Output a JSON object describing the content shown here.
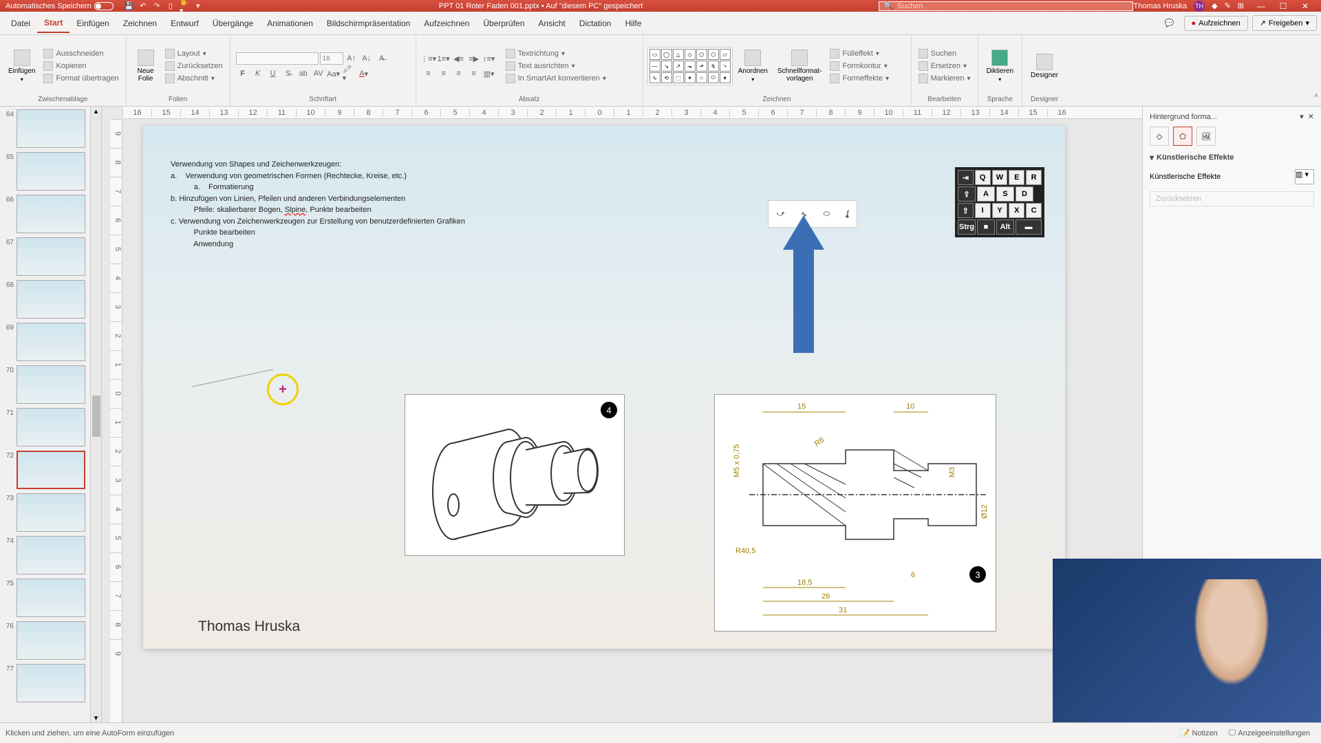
{
  "titlebar": {
    "autosave": "Automatisches Speichern",
    "filename": "PPT 01 Roter Faden 001.pptx • Auf \"diesem PC\" gespeichert",
    "search_placeholder": "Suchen",
    "user": "Thomas Hruska",
    "user_initials": "TH"
  },
  "tabs": {
    "items": [
      "Datei",
      "Start",
      "Einfügen",
      "Zeichnen",
      "Entwurf",
      "Übergänge",
      "Animationen",
      "Bildschirmpräsentation",
      "Aufzeichnen",
      "Überprüfen",
      "Ansicht",
      "Dictation",
      "Hilfe"
    ],
    "active": 1,
    "record": "Aufzeichnen",
    "share": "Freigeben"
  },
  "ribbon": {
    "clipboard": {
      "title": "Zwischenablage",
      "paste": "Einfügen",
      "cut": "Ausschneiden",
      "copy": "Kopieren",
      "format": "Format übertragen"
    },
    "slides": {
      "title": "Folien",
      "new": "Neue\nFolie",
      "layout": "Layout",
      "reset": "Zurücksetzen",
      "section": "Abschnitt"
    },
    "font": {
      "title": "Schriftart",
      "size": "18"
    },
    "paragraph": {
      "title": "Absatz",
      "dir": "Textrichtung",
      "align": "Text ausrichten",
      "smartart": "In SmartArt konvertieren"
    },
    "drawing": {
      "title": "Zeichnen",
      "arrange": "Anordnen",
      "quick": "Schnellformat-\nvorlagen",
      "fill": "Fülleffekt",
      "outline": "Formkontur",
      "effects": "Formeffekte"
    },
    "editing": {
      "title": "Bearbeiten",
      "find": "Suchen",
      "replace": "Ersetzen",
      "select": "Markieren"
    },
    "voice": {
      "title": "Sprache",
      "dictate": "Diktieren"
    },
    "designer": {
      "title": "Designer",
      "btn": "Designer"
    }
  },
  "thumbs": {
    "start": 64,
    "hasStar": [
      65,
      67,
      69,
      70
    ],
    "selected": 72
  },
  "slide": {
    "lines": [
      "Verwendung von Shapes und Zeichenwerkzeugen:",
      "a.    Verwendung von geometrischen Formen (Rechtecke, Kreise, etc.)",
      "           a.    Formatierung",
      "b. Hinzufügen von Linien, Pfeilen und anderen Verbindungselementen",
      "           Pfeile: skalierbarer Bogen, ",
      ", Punkte bearbeiten",
      "c. Verwendung von Zeichenwerkzeugen zur Erstellung von benutzerdefinierten Grafiken",
      "           Punkte bearbeiten",
      "           Anwendung"
    ],
    "slpine": "Slpine",
    "author": "Thomas Hruska",
    "badge4": "4",
    "badge3": "3",
    "kbd_rows": [
      [
        "⇥",
        "Q",
        "W",
        "E",
        "R"
      ],
      [
        "⇪",
        "A",
        "S",
        "D"
      ],
      [
        "⇧",
        "I",
        "Y",
        "X",
        "C"
      ],
      [
        "Strg",
        "■",
        "Alt",
        "▬"
      ]
    ],
    "dims": {
      "d15": "15",
      "d10": "10",
      "d185": "18,5",
      "d26": "26",
      "d31": "31",
      "d6": "6",
      "r405": "R40,5",
      "m5": "M5 x 0,75",
      "m3": "M3",
      "d12": "Ø12",
      "r8": "R8"
    }
  },
  "sidepanel": {
    "title": "Hintergrund forma...",
    "section": "Künstlerische Effekte",
    "label": "Künstlerische Effekte",
    "reset": "Zurücksetzen"
  },
  "statusbar": {
    "hint": "Klicken und ziehen, um eine AutoForm einzufügen",
    "notes": "Notizen",
    "display": "Anzeigeeinstellungen"
  }
}
